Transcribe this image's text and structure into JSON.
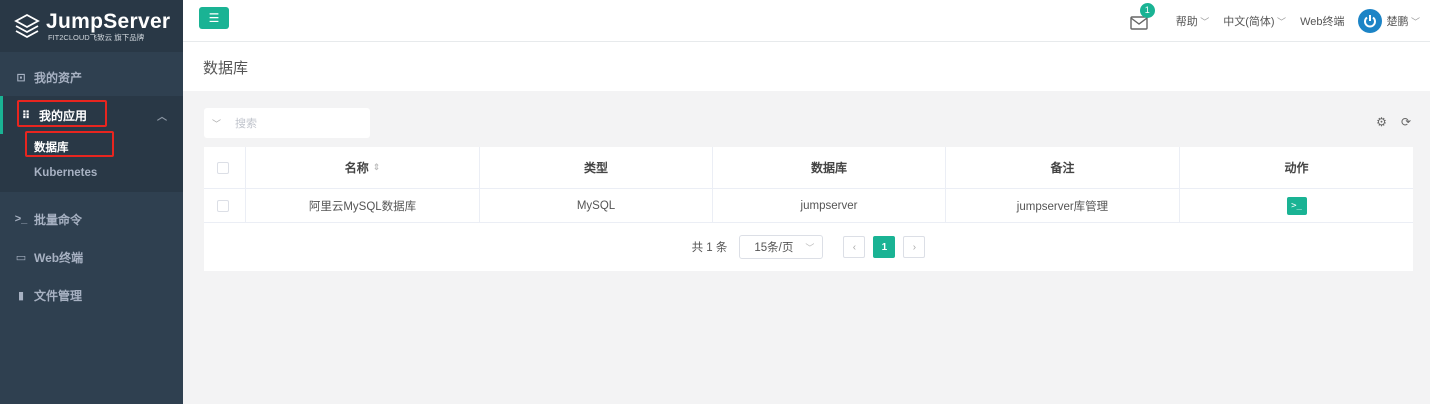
{
  "brand": {
    "title": "JumpServer",
    "subtitle": "FIT2CLOUD飞致云 旗下品牌"
  },
  "sidebar": {
    "my_assets": "我的资产",
    "my_apps": "我的应用",
    "sub_items": [
      "数据库",
      "Kubernetes"
    ],
    "batch_cmd": "批量命令",
    "web_terminal": "Web终端",
    "file_mgmt": "文件管理"
  },
  "topbar": {
    "mail_count": "1",
    "help": "帮助",
    "language": "中文(简体)",
    "web_terminal": "Web终端",
    "user": "楚鹏"
  },
  "page": {
    "title": "数据库"
  },
  "search": {
    "placeholder": "搜索"
  },
  "table": {
    "columns": [
      "名称",
      "类型",
      "数据库",
      "备注",
      "动作"
    ],
    "rows": [
      {
        "name": "阿里云MySQL数据库",
        "type": "MySQL",
        "database": "jumpserver",
        "comment": "jumpserver库管理",
        "action_icon": ">_"
      }
    ]
  },
  "pagination": {
    "total": "共 1 条",
    "page_size": "15条/页",
    "current": "1"
  },
  "colors": {
    "sidebar": "#2f4050",
    "accent": "#1ab394",
    "highlight": "#e8251f"
  }
}
